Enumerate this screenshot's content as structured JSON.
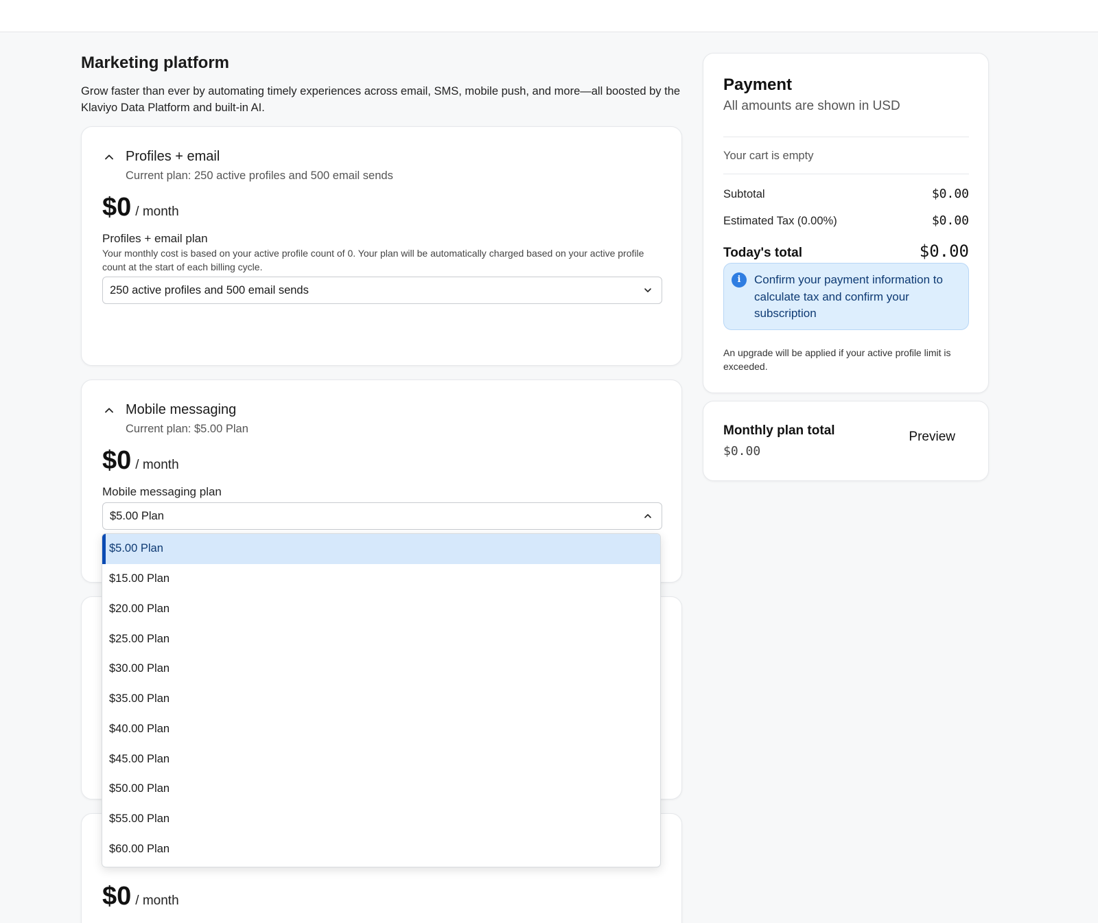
{
  "page": {
    "title": "Marketing platform",
    "description": "Grow faster than ever by automating timely experiences across email, SMS, mobile push, and more—all boosted by the Klaviyo Data Platform and built-in AI."
  },
  "sections": {
    "profiles_email": {
      "title": "Profiles + email",
      "current_plan": "Current plan: 250 active profiles and 500 email sends",
      "price": "$0",
      "per": "/ month",
      "field_label": "Profiles + email plan",
      "help": "Your monthly cost is based on your active profile count of 0. Your plan will be automatically charged based on your active profile count at the start of each billing cycle.",
      "selected": "250 active profiles and 500 email sends"
    },
    "mobile_messaging": {
      "title": "Mobile messaging",
      "current_plan": "Current plan: $5.00 Plan",
      "price": "$0",
      "per": "/ month",
      "field_label": "Mobile messaging plan",
      "selected": "$5.00 Plan",
      "options": [
        "$5.00 Plan",
        "$15.00 Plan",
        "$20.00 Plan",
        "$25.00 Plan",
        "$30.00 Plan",
        "$35.00 Plan",
        "$40.00 Plan",
        "$45.00 Plan",
        "$50.00 Plan",
        "$55.00 Plan",
        "$60.00 Plan"
      ]
    },
    "social_marketing": {
      "price": "$0",
      "per": "/ month"
    }
  },
  "payment": {
    "title": "Payment",
    "subtitle": "All amounts are shown in USD",
    "cart_empty": "Your cart is empty",
    "subtotal_label": "Subtotal",
    "subtotal_value": "$0.00",
    "tax_label": "Estimated Tax (0.00%)",
    "tax_value": "$0.00",
    "total_label": "Today's total",
    "total_value": "$0.00",
    "info_text": "Confirm your payment information to calculate tax and confirm your subscription",
    "upgrade_note": "An upgrade will be applied if your active profile limit is exceeded."
  },
  "monthly_total": {
    "label": "Monthly plan total",
    "value": "$0.00",
    "preview_label": "Preview"
  },
  "colors": {
    "accent": "#0b4bb3",
    "selected_bg": "#d6e8fb",
    "info_bg": "#ddeefd",
    "info_icon": "#2f7de1"
  }
}
